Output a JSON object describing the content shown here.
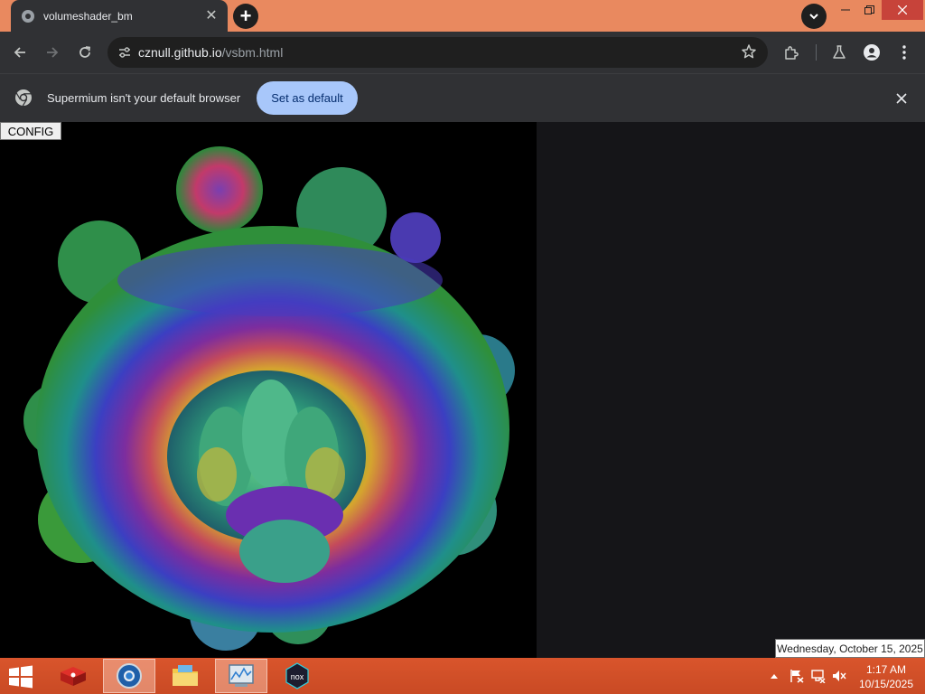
{
  "browser": {
    "tab": {
      "title": "volumeshader_bm",
      "close_glyph": "✕",
      "favicon": "globe-icon"
    },
    "new_tab_glyph": "+",
    "omnibox": {
      "host": "cznull.github.io",
      "path": "/vsbm.html"
    }
  },
  "infobar": {
    "message": "Supermium isn't your default browser",
    "button_label": "Set as default"
  },
  "page": {
    "config_button": "CONFIG",
    "canvas_content": "mandelbulb-fractal-render"
  },
  "tooltip": {
    "text": "Wednesday, October 15, 2025"
  },
  "taskbar": {
    "apps": [
      "app-icon-red-box",
      "supermium-icon",
      "file-explorer-icon",
      "task-manager-icon",
      "nox-icon"
    ],
    "nox_label": "nox",
    "clock": {
      "time": "1:17 AM",
      "date": "10/15/2025"
    }
  },
  "colors": {
    "titlebar": "#e9895f",
    "toolbar": "#303134",
    "accent_button": "#a8c7fa",
    "taskbar": "#d9552c",
    "page_background": "#151518"
  }
}
